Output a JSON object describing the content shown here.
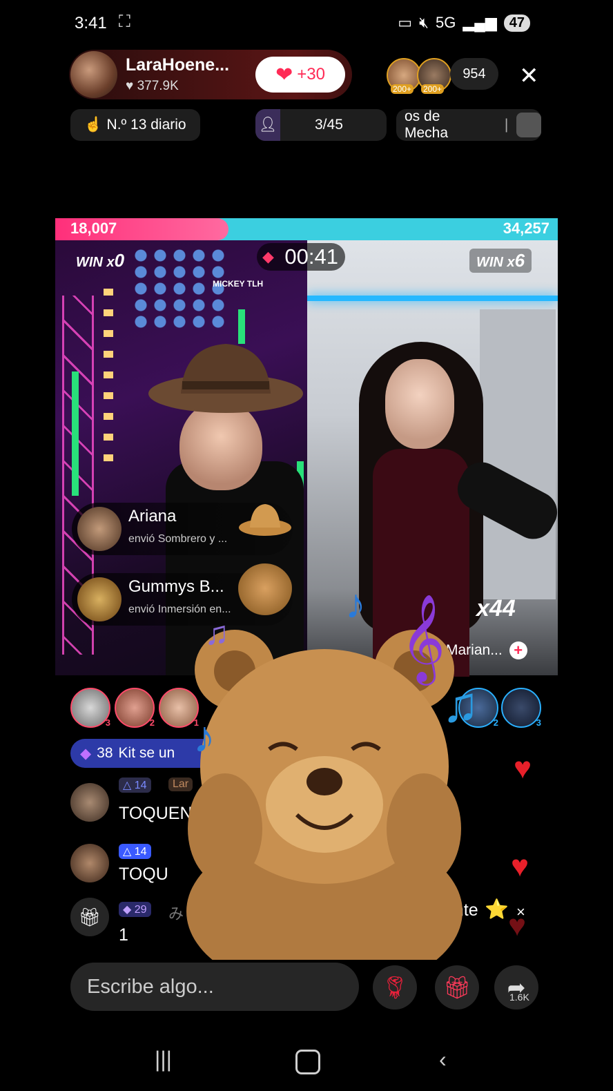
{
  "status_bar": {
    "time": "3:41",
    "network": "5G",
    "battery": "47"
  },
  "host": {
    "name": "LaraHoene...",
    "likes": "377.9K",
    "like_button": "+30"
  },
  "viewers": {
    "badges": [
      "200+",
      "200+"
    ],
    "count": "954"
  },
  "ribbon": {
    "rank": "N.º 13 diario",
    "progress": "3/45",
    "ticker": "os de Mecha"
  },
  "battle": {
    "left_score": "18,007",
    "right_score": "34,257",
    "left_share": 0.345,
    "timer": "00:41",
    "left_wins": "0",
    "right_wins": "6",
    "win_label": "WIN",
    "mult": "x"
  },
  "overlay_tag": "MICKEY  TLH",
  "gift_notifications": [
    {
      "name": "Ariana",
      "detail": "envió Sombrero y ..."
    },
    {
      "name": "Gummys B...",
      "detail": "envió Inmersión en..."
    }
  ],
  "combo": "x44",
  "guest_name": "Marian...",
  "top_gifters": [
    {
      "rank": "3"
    },
    {
      "rank": "2"
    },
    {
      "rank": "1"
    }
  ],
  "top_gifters_right": [
    {
      "rank": "2"
    },
    {
      "rank": "3"
    }
  ],
  "chat": {
    "pinned": {
      "diamonds": "38",
      "text": "Kit se un"
    },
    "messages": [
      {
        "level": "14",
        "badge": "Lar",
        "text": "TOQUEN E"
      },
      {
        "level": "14",
        "badge": "",
        "text": "TOQU"
      },
      {
        "level": "29",
        "badge": "み",
        "text": "1",
        "trail": "ante"
      }
    ]
  },
  "input": {
    "placeholder": "Escribe algo..."
  },
  "share_count": "1.6K"
}
